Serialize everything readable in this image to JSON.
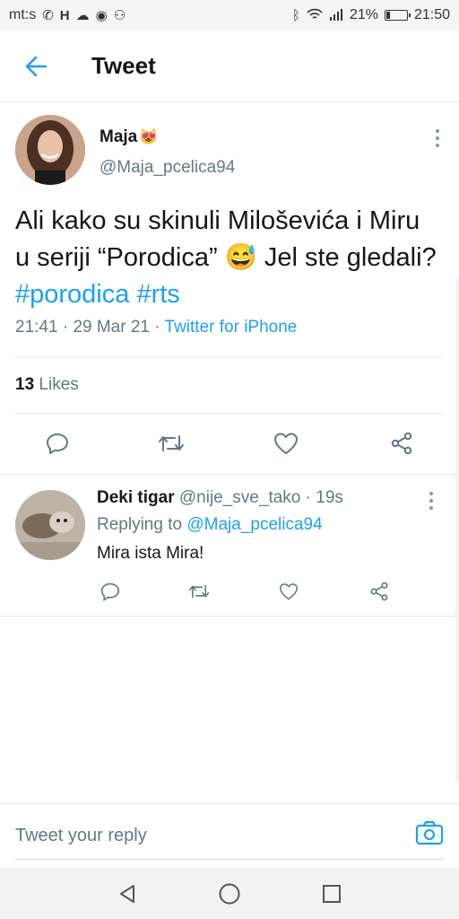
{
  "status_bar": {
    "carrier": "mt:s",
    "battery": "21%",
    "time": "21:50",
    "battery_level": 0.21
  },
  "header": {
    "back_icon": "arrow-left-icon",
    "title": "Tweet"
  },
  "tweet": {
    "author_name": "Maja",
    "author_emoji": "😻",
    "author_handle": "@Maja_pcelica94",
    "text_main": "Ali kako su skinuli Miloševića i Miru u seriji “Porodica” ",
    "text_emoji": "😅",
    "text_after": " Jel ste gledali? ",
    "hashtags": [
      "#porodica",
      "#rts"
    ],
    "time": "21:41",
    "date": "29 Mar 21",
    "sep": "·",
    "source": "Twitter for iPhone",
    "likes_count": "13",
    "likes_label": "Likes"
  },
  "reply": {
    "name": "Deki tigar",
    "handle": "@nije_sve_tako",
    "sep": "·",
    "age": "19s",
    "replying_prefix": "Replying to",
    "replying_to": "@Maja_pcelica94",
    "text": "Mira ista Mira!"
  },
  "compose": {
    "placeholder": "Tweet your reply"
  },
  "colors": {
    "accent": "#1da1f2",
    "text": "#14171a",
    "muted": "#657786",
    "divider": "#e1e8ed"
  }
}
